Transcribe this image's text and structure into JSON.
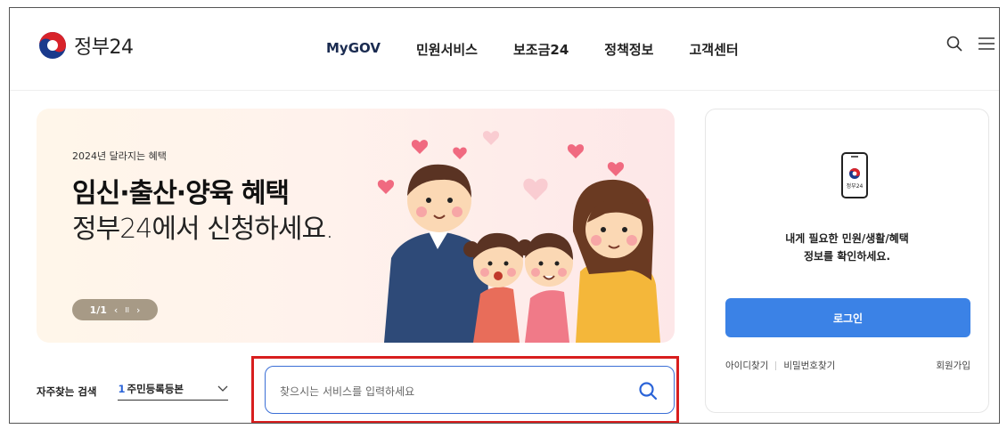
{
  "header": {
    "logo_text": "정부24",
    "nav": [
      "MyGOV",
      "민원서비스",
      "보조금24",
      "정책정보",
      "고객센터"
    ],
    "icons": [
      "search-icon",
      "menu-icon"
    ]
  },
  "banner": {
    "subtitle": "2024년 달라지는 혜택",
    "title_line1": "임신·출산·양육 혜택",
    "title_line2": "정부24에서 신청하세요.",
    "pager": {
      "count": "1/1",
      "prev": "‹",
      "pause": "II",
      "next": "›"
    }
  },
  "login_panel": {
    "icon_label": "정부24",
    "message_line1": "내게 필요한 민원/생활/혜택",
    "message_line2": "정보를 확인하세요.",
    "login_button": "로그인",
    "links": [
      "아이디찾기",
      "비밀번호찾기",
      "회원가입"
    ]
  },
  "frequent_search": {
    "label": "자주찾는 검색",
    "rank": "1",
    "value": "주민등록등본"
  },
  "search": {
    "placeholder": "찾으시는 서비스를 입력하세요"
  },
  "colors": {
    "accent": "#3b82e6",
    "highlight_border": "#d81e1e",
    "pager_bg": "#a79a86"
  }
}
